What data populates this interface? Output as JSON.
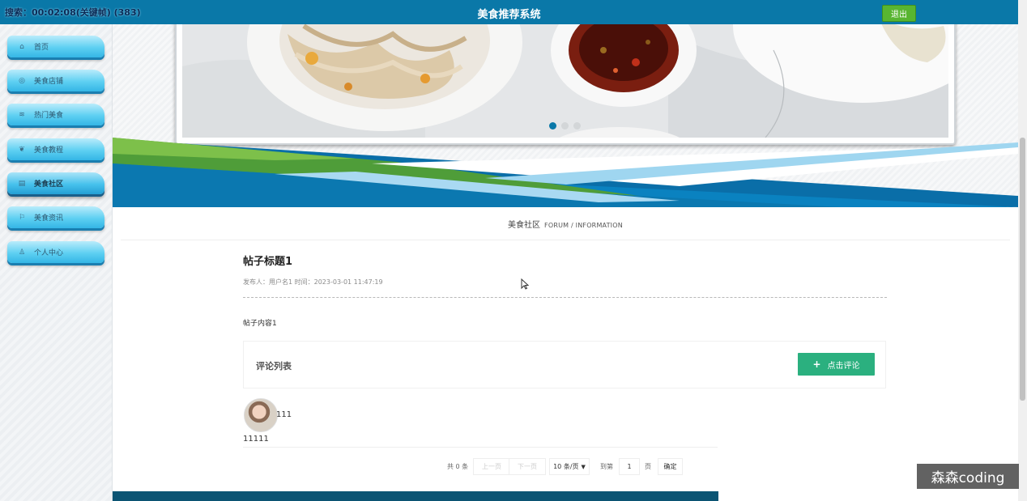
{
  "topbar": {
    "timer": "搜索：00:02:08(关键帧) (383)",
    "title": "美食推荐系统",
    "logout_label": "退出"
  },
  "sidebar": {
    "items": [
      {
        "label": "首页",
        "icon": "home-icon",
        "glyph": "⌂"
      },
      {
        "label": "美食店铺",
        "icon": "shop-icon",
        "glyph": "◎"
      },
      {
        "label": "热门美食",
        "icon": "hot-food-icon",
        "glyph": "≋"
      },
      {
        "label": "美食教程",
        "icon": "tutorial-icon",
        "glyph": "❦"
      },
      {
        "label": "美食社区",
        "icon": "community-icon",
        "glyph": "▤",
        "active": true
      },
      {
        "label": "美食资讯",
        "icon": "flag-icon",
        "glyph": "⚐"
      },
      {
        "label": "个人中心",
        "icon": "user-icon",
        "glyph": "♙"
      }
    ]
  },
  "section": {
    "title_zh": "美食社区",
    "title_en": "FORUM / INFORMATION"
  },
  "post": {
    "title": "帖子标题1",
    "meta": "发布人：用户名1 时间：2023-03-01 11:47:19",
    "content": "帖子内容1"
  },
  "comments": {
    "header": "评论列表",
    "add_label": "点击评论",
    "items": [
      {
        "user": "111",
        "text": "11111"
      }
    ]
  },
  "pagination": {
    "total": "共 0 条",
    "prev": "上一页",
    "next": "下一页",
    "page_size": "10 条/页",
    "goto_label": "到第",
    "page_value": "1",
    "page_unit": "页",
    "confirm": "确定"
  },
  "watermark": "森森coding",
  "colors": {
    "topbar": "#0a78a8",
    "logout": "#58b531",
    "comment_button": "#2bb07f",
    "dot_active": "#0a78a8"
  }
}
